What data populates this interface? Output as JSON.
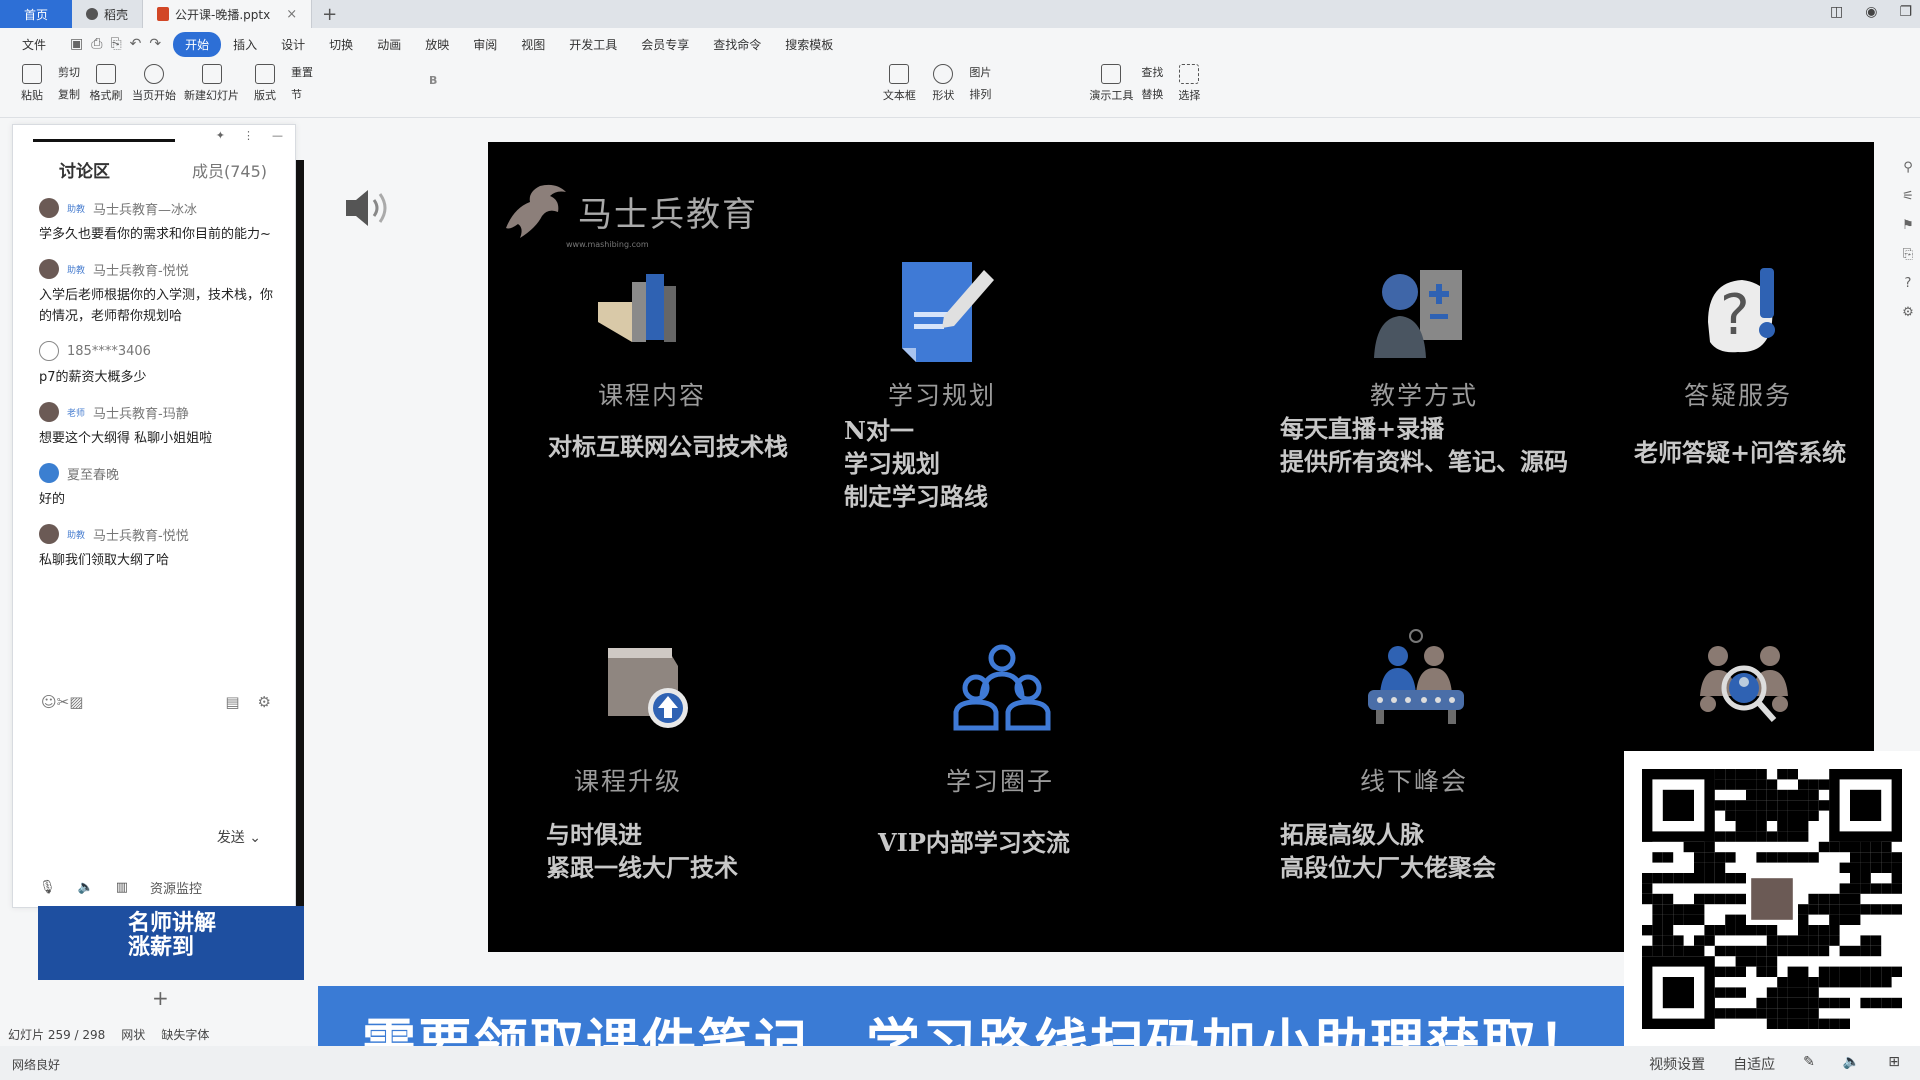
{
  "tabs": {
    "home": "首页",
    "tab1": "稻壳",
    "tab2": "公开课-晚播.pptx"
  },
  "menu": {
    "items": [
      "文件",
      "开始",
      "插入",
      "设计",
      "切换",
      "动画",
      "放映",
      "审阅",
      "视图",
      "开发工具",
      "会员专享",
      "查找命令",
      "搜索模板"
    ],
    "active": "开始"
  },
  "ribbon": {
    "paste": "粘贴",
    "cut": "剪切",
    "copy": "复制",
    "format_painter": "格式刷",
    "from_current": "当页开始",
    "new_slide": "新建幻灯片",
    "layout": "版式",
    "section": "节",
    "reset": "重置",
    "textbox": "文本框",
    "shape": "形状",
    "picture": "图片",
    "arrange": "排列",
    "present_tools": "演示工具",
    "find": "查找",
    "replace": "替换",
    "select": "选择"
  },
  "chat": {
    "tab_discussion": "讨论区",
    "tab_members": "成员(745)",
    "messages": [
      {
        "role": "助教",
        "name": "马士兵教育—冰冰",
        "text": "学多久也要看你的需求和你目前的能力~"
      },
      {
        "role": "助教",
        "name": "马士兵教育-悦悦",
        "text": "入学后老师根据你的入学测，技术栈，你的情况，老师帮你规划哈"
      },
      {
        "role": "",
        "name": "185****3406",
        "text": "p7的薪资大概多少"
      },
      {
        "role": "老师",
        "name": "马士兵教育-玛静",
        "text": "想要这个大纲得 私聊小姐姐啦"
      },
      {
        "role": "",
        "name": "夏至春晚",
        "text": "好的"
      },
      {
        "role": "助教",
        "name": "马士兵教育-悦悦",
        "text": "私聊我们领取大纲了哈"
      }
    ],
    "send": "发送",
    "resource_monitor": "资源监控"
  },
  "thumb": {
    "text": "名师讲解涨薪到"
  },
  "status": {
    "slide_no": "幻灯片 259 / 298",
    "theme": "网状",
    "missing_font": "缺失字体",
    "network": "网络良好",
    "view_settings": "视频设置",
    "fit": "自适应"
  },
  "slide": {
    "logo_text": "马士兵教育",
    "logo_url": "www.mashibing.com",
    "cells": [
      {
        "title": "课程内容",
        "desc": [
          "对标互联网公司技术栈"
        ],
        "icon": "books-icon"
      },
      {
        "title": "学习规划",
        "desc": [
          "N对一",
          "学习规划",
          "制定学习路线"
        ],
        "icon": "document-pen-icon"
      },
      {
        "title": "教学方式",
        "desc": [
          "每天直播+录播",
          "提供所有资料、笔记、源码"
        ],
        "icon": "teacher-board-icon"
      },
      {
        "title": "答疑服务",
        "desc": [
          "老师答疑+问答系统"
        ],
        "icon": "question-icon"
      },
      {
        "title": "课程升级",
        "desc": [
          "与时俱进",
          "紧跟一线大厂技术"
        ],
        "icon": "box-upgrade-icon"
      },
      {
        "title": "学习圈子",
        "desc": [
          "VIP内部学习交流"
        ],
        "icon": "group-icon"
      },
      {
        "title": "线下峰会",
        "desc": [
          "拓展高级人脉",
          "高段位大厂大佬聚会"
        ],
        "icon": "meeting-icon"
      },
      {
        "title": "",
        "desc": [],
        "icon": "people-search-icon"
      }
    ]
  },
  "banner": {
    "text": "需要领取课件笔记、学习路线扫码加小助理获取！"
  },
  "colors": {
    "accent": "#2d6fd6",
    "banner": "#3a7bd5",
    "slide_bg": "#000000"
  }
}
